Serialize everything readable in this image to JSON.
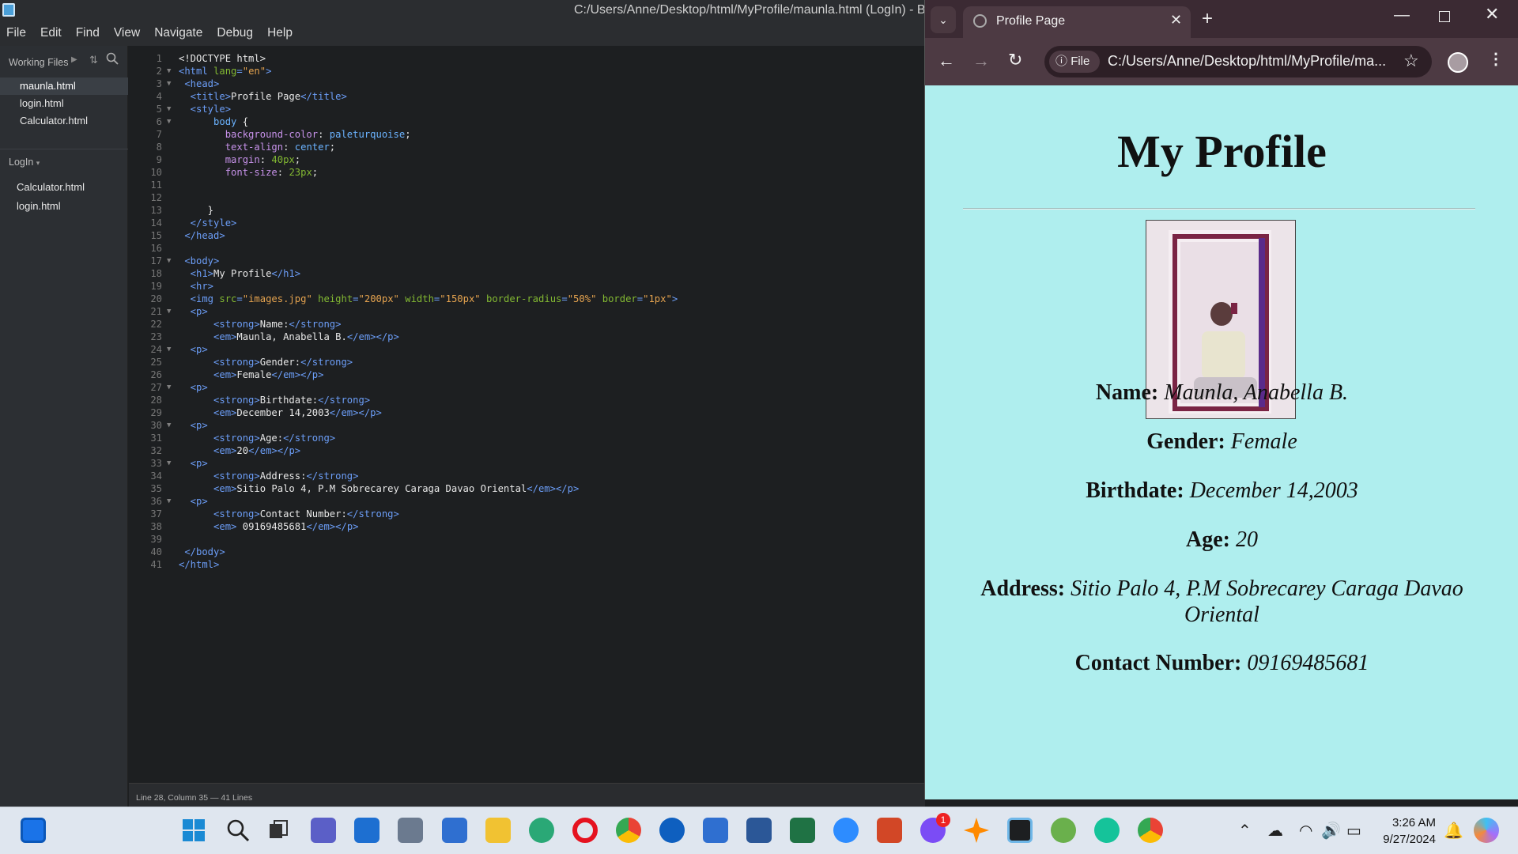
{
  "editor": {
    "title": "C:/Users/Anne/Desktop/html/MyProfile/maunla.html (LogIn) - Brackets",
    "menu": [
      "File",
      "Edit",
      "Find",
      "View",
      "Navigate",
      "Debug",
      "Help"
    ],
    "working_files_label": "Working Files",
    "working_files": [
      "maunla.html",
      "login.html",
      "Calculator.html"
    ],
    "project_label": "LogIn",
    "project_files": [
      "Calculator.html",
      "login.html"
    ],
    "status": "Line 28, Column 35 — 41 Lines"
  },
  "code_lines": [
    [
      [
        "tx",
        "<!DOCTYPE html>"
      ]
    ],
    [
      [
        "t",
        "<html "
      ],
      [
        "a",
        "lang"
      ],
      [
        "t",
        "="
      ],
      [
        "v",
        "\"en\""
      ],
      [
        "t",
        ">"
      ]
    ],
    [
      [
        "t",
        " <head>"
      ]
    ],
    [
      [
        "t",
        "  <title>"
      ],
      [
        "tx",
        "Profile Page"
      ],
      [
        "t",
        "</title>"
      ]
    ],
    [
      [
        "t",
        "  <style>"
      ]
    ],
    [
      [
        "tx",
        "      "
      ],
      [
        "pv",
        "body"
      ],
      [
        "tx",
        " {"
      ]
    ],
    [
      [
        "tx",
        "        "
      ],
      [
        "p",
        "background-color"
      ],
      [
        "tx",
        ": "
      ],
      [
        "pv",
        "paleturquoise"
      ],
      [
        "tx",
        ";"
      ]
    ],
    [
      [
        "tx",
        "        "
      ],
      [
        "p",
        "text-align"
      ],
      [
        "tx",
        ": "
      ],
      [
        "pv",
        "center"
      ],
      [
        "tx",
        ";"
      ]
    ],
    [
      [
        "tx",
        "        "
      ],
      [
        "p",
        "margin"
      ],
      [
        "tx",
        ": "
      ],
      [
        "nm",
        "40px"
      ],
      [
        "tx",
        ";"
      ]
    ],
    [
      [
        "tx",
        "        "
      ],
      [
        "p",
        "font-size"
      ],
      [
        "tx",
        ": "
      ],
      [
        "nm",
        "23px"
      ],
      [
        "tx",
        ";"
      ]
    ],
    [],
    [],
    [
      [
        "tx",
        "     }"
      ]
    ],
    [
      [
        "t",
        "  </style>"
      ]
    ],
    [
      [
        "t",
        " </head>"
      ]
    ],
    [],
    [
      [
        "t",
        " <body>"
      ]
    ],
    [
      [
        "t",
        "  <h1>"
      ],
      [
        "tx",
        "My Profile"
      ],
      [
        "t",
        "</h1>"
      ]
    ],
    [
      [
        "t",
        "  <hr>"
      ]
    ],
    [
      [
        "t",
        "  <img "
      ],
      [
        "a",
        "src"
      ],
      [
        "t",
        "="
      ],
      [
        "v",
        "\"images.jpg\""
      ],
      [
        "a",
        " height"
      ],
      [
        "t",
        "="
      ],
      [
        "v",
        "\"200px\""
      ],
      [
        "a",
        " width"
      ],
      [
        "t",
        "="
      ],
      [
        "v",
        "\"150px\""
      ],
      [
        "a",
        " border-radius"
      ],
      [
        "t",
        "="
      ],
      [
        "v",
        "\"50%\""
      ],
      [
        "a",
        " border"
      ],
      [
        "t",
        "="
      ],
      [
        "v",
        "\"1px\""
      ],
      [
        "t",
        ">"
      ]
    ],
    [
      [
        "t",
        "  <p>"
      ]
    ],
    [
      [
        "tx",
        "      "
      ],
      [
        "t",
        "<strong>"
      ],
      [
        "tx",
        "Name:"
      ],
      [
        "t",
        "</strong>"
      ]
    ],
    [
      [
        "tx",
        "      "
      ],
      [
        "t",
        "<em>"
      ],
      [
        "tx",
        "Maunla, Anabella B."
      ],
      [
        "t",
        "</em></p>"
      ]
    ],
    [
      [
        "t",
        "  <p>"
      ]
    ],
    [
      [
        "tx",
        "      "
      ],
      [
        "t",
        "<strong>"
      ],
      [
        "tx",
        "Gender:"
      ],
      [
        "t",
        "</strong>"
      ]
    ],
    [
      [
        "tx",
        "      "
      ],
      [
        "t",
        "<em>"
      ],
      [
        "tx",
        "Female"
      ],
      [
        "t",
        "</em></p>"
      ]
    ],
    [
      [
        "t",
        "  <p>"
      ]
    ],
    [
      [
        "tx",
        "      "
      ],
      [
        "t",
        "<strong>"
      ],
      [
        "tx",
        "Birthdate:"
      ],
      [
        "t",
        "</strong>"
      ]
    ],
    [
      [
        "tx",
        "      "
      ],
      [
        "t",
        "<em>"
      ],
      [
        "tx",
        "December 14,2003"
      ],
      [
        "t",
        "</em></p>"
      ]
    ],
    [
      [
        "t",
        "  <p>"
      ]
    ],
    [
      [
        "tx",
        "      "
      ],
      [
        "t",
        "<strong>"
      ],
      [
        "tx",
        "Age:"
      ],
      [
        "t",
        "</strong>"
      ]
    ],
    [
      [
        "tx",
        "      "
      ],
      [
        "t",
        "<em>"
      ],
      [
        "tx",
        "20"
      ],
      [
        "t",
        "</em></p>"
      ]
    ],
    [
      [
        "t",
        "  <p>"
      ]
    ],
    [
      [
        "tx",
        "      "
      ],
      [
        "t",
        "<strong>"
      ],
      [
        "tx",
        "Address:"
      ],
      [
        "t",
        "</strong>"
      ]
    ],
    [
      [
        "tx",
        "      "
      ],
      [
        "t",
        "<em>"
      ],
      [
        "tx",
        "Sitio Palo 4, P.M Sobrecarey Caraga Davao Oriental"
      ],
      [
        "t",
        "</em></p>"
      ]
    ],
    [
      [
        "t",
        "  <p>"
      ]
    ],
    [
      [
        "tx",
        "      "
      ],
      [
        "t",
        "<strong>"
      ],
      [
        "tx",
        "Contact Number:"
      ],
      [
        "t",
        "</strong>"
      ]
    ],
    [
      [
        "tx",
        "      "
      ],
      [
        "t",
        "<em>"
      ],
      [
        "tx",
        " 09169485681"
      ],
      [
        "t",
        "</em></p>"
      ]
    ],
    [],
    [
      [
        "t",
        " </body>"
      ]
    ],
    [
      [
        "t",
        "</html>"
      ]
    ]
  ],
  "fold_lines": [
    2,
    3,
    5,
    6,
    17,
    21,
    24,
    27,
    30,
    33,
    36
  ],
  "browser": {
    "tab_title": "Profile Page",
    "site_chip": "File",
    "url": "C:/Users/Anne/Desktop/html/MyProfile/ma...",
    "page": {
      "heading": "My Profile",
      "fields": [
        {
          "label": "Name:",
          "value": "Maunla, Anabella B."
        },
        {
          "label": "Gender:",
          "value": "Female"
        },
        {
          "label": "Birthdate:",
          "value": "December 14,2003"
        },
        {
          "label": "Age:",
          "value": "20"
        },
        {
          "label": "Address:",
          "value": "Sitio Palo 4, P.M Sobrecarey Caraga Davao Oriental"
        },
        {
          "label": "Contact Number:",
          "value": "09169485681"
        }
      ]
    }
  },
  "taskbar": {
    "time": "3:26 AM",
    "date": "9/27/2024",
    "messenger_badge": "1",
    "apps": [
      "widgets-icon",
      "start-icon",
      "search-icon",
      "task-view-icon",
      "meet-icon",
      "store-icon",
      "calculator-icon",
      "notepad-icon",
      "file-explorer-icon",
      "edge-icon",
      "opera-icon",
      "chrome-icon",
      "teamviewer-icon",
      "mail-icon",
      "word-icon",
      "excel-icon",
      "zoom-icon",
      "powerpoint-icon",
      "messenger-icon",
      "app-star-icon",
      "brackets-icon",
      "vpn-icon",
      "grammarly-icon",
      "chrome-active-icon"
    ]
  },
  "colors": {
    "page_bg": "#afeeee",
    "editor_bg": "#1d1f21",
    "tab_strip": "#3b2a33"
  }
}
